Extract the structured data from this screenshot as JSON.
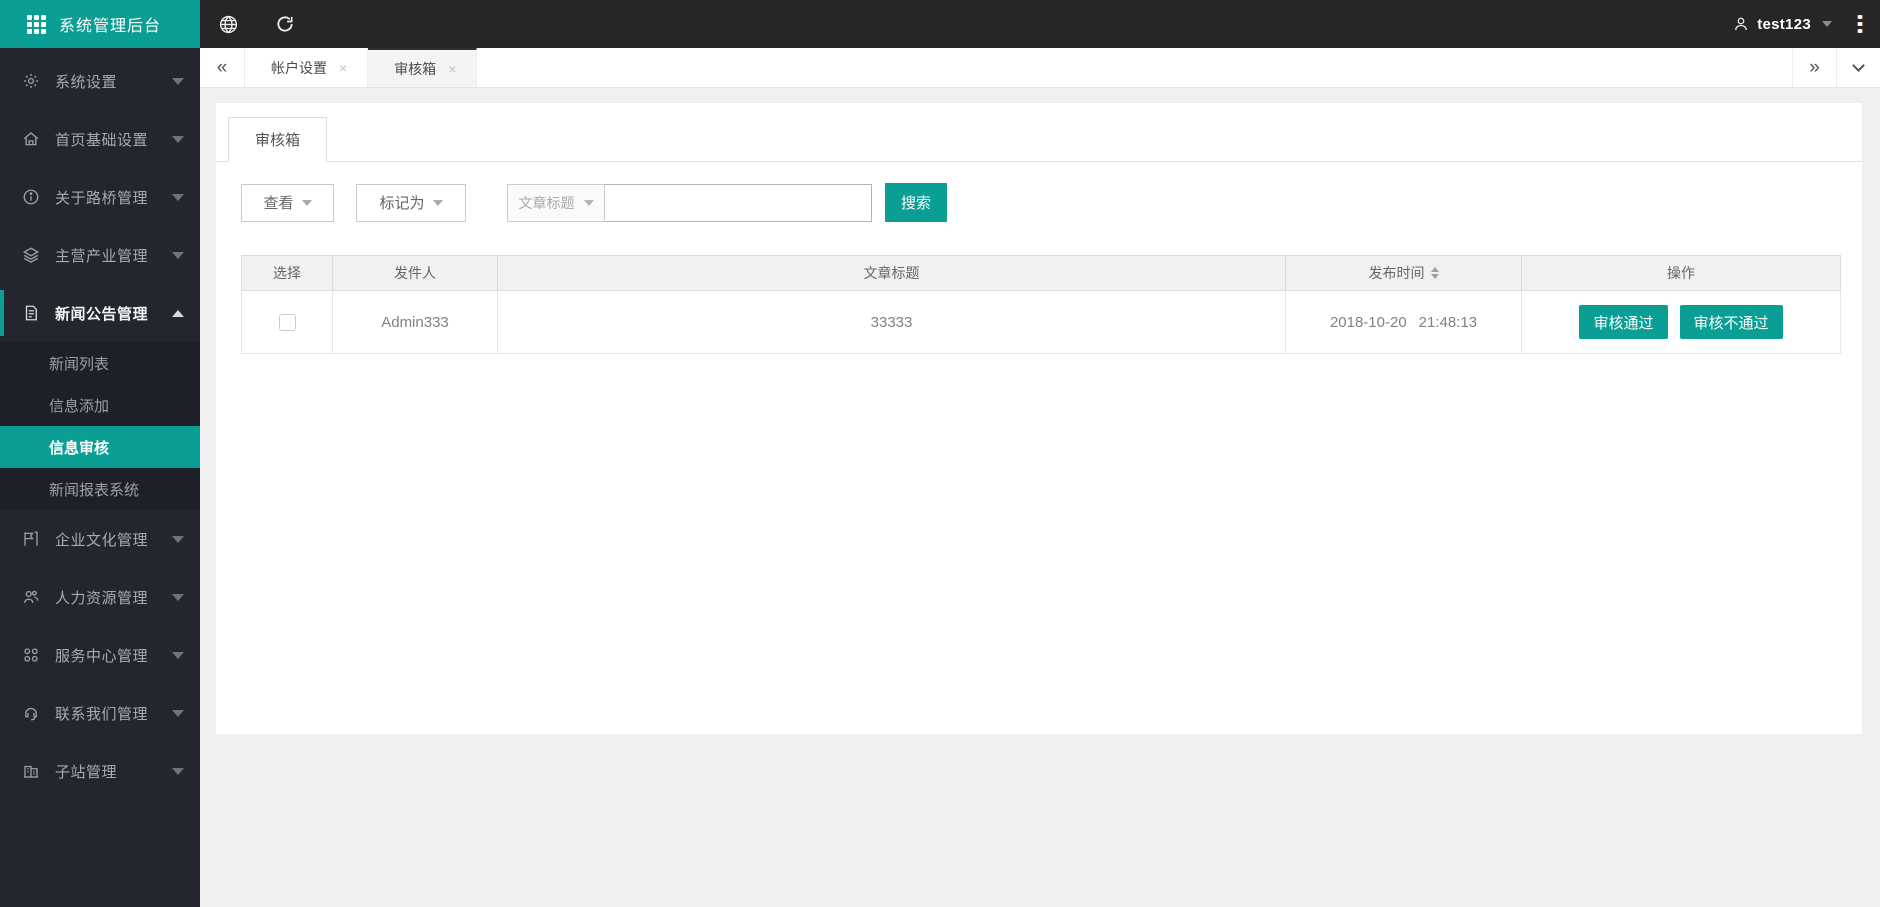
{
  "app": {
    "title": "系统管理后台"
  },
  "topbar": {
    "icons": [
      "globe-icon",
      "refresh-icon"
    ],
    "user": {
      "name": "test123"
    }
  },
  "tabbar": {
    "tabs": [
      {
        "label": "帐户设置",
        "active": false,
        "closable": true
      },
      {
        "label": "审核箱",
        "active": true,
        "closable": true
      }
    ],
    "scroll_left": "«",
    "scroll_right": "»",
    "close_glyph": "×"
  },
  "sidebar": {
    "items": [
      {
        "label": "系统设置",
        "icon": "gear-icon"
      },
      {
        "label": "首页基础设置",
        "icon": "home-icon"
      },
      {
        "label": "关于路桥管理",
        "icon": "info-icon"
      },
      {
        "label": "主营产业管理",
        "icon": "layers-icon"
      },
      {
        "label": "新闻公告管理",
        "icon": "document-icon",
        "expanded": true,
        "children": [
          "新闻列表",
          "信息添加",
          "信息审核",
          "新闻报表系统"
        ],
        "active_child": "信息审核"
      },
      {
        "label": "企业文化管理",
        "icon": "flag-icon"
      },
      {
        "label": "人力资源管理",
        "icon": "people-icon"
      },
      {
        "label": "服务中心管理",
        "icon": "command-icon"
      },
      {
        "label": "联系我们管理",
        "icon": "headset-icon"
      },
      {
        "label": "子站管理",
        "icon": "building-icon"
      }
    ]
  },
  "panel": {
    "tab_label": "审核箱",
    "filters": {
      "view_label": "查看",
      "mark_label": "标记为",
      "field_label": "文章标题",
      "input_value": "",
      "search_label": "搜索"
    },
    "table": {
      "headers": [
        "选择",
        "发件人",
        "文章标题",
        "发布时间",
        "操作"
      ],
      "rows": [
        {
          "checked": false,
          "sender": "Admin333",
          "title": "33333",
          "date": "2018-10-20",
          "time": "21:48:13",
          "approve_label": "审核通过",
          "reject_label": "审核不通过"
        }
      ]
    }
  },
  "colors": {
    "brand_teal": "#0b9e94",
    "topbar_bg": "#262626",
    "sidebar_bg": "#23262d",
    "submenu_bg": "#1d2026",
    "content_bg": "#efefef",
    "header_row_bg": "#f1f1f1"
  }
}
